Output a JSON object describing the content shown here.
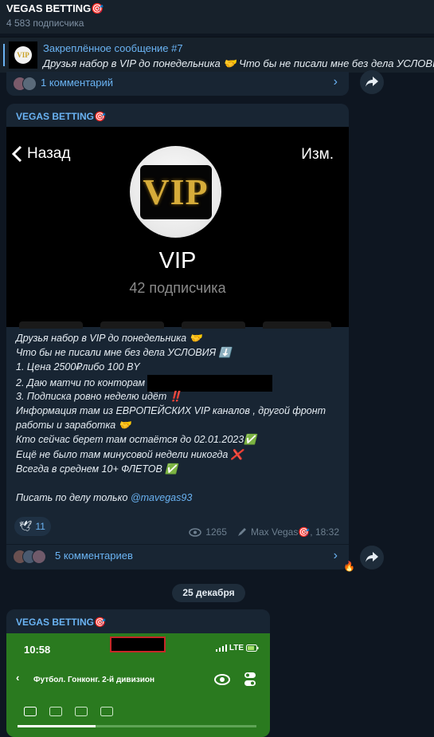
{
  "header": {
    "title": "VEGAS BETTING🎯",
    "subscribers": "4 583 подписчика"
  },
  "pinned": {
    "title": "Закреплённое сообщение #7",
    "text": "Друзья набор в VIP до понедельника 🤝 Что бы не писали мне без дела УСЛОВИЯ",
    "thumb_text": "VIP"
  },
  "top_comments": {
    "label": "1 комментарий"
  },
  "message": {
    "author": "VEGAS BETTING🎯",
    "screenshot": {
      "back": "Назад",
      "edit": "Изм.",
      "logo_text": "VIP",
      "name": "VIP",
      "subs": "42 подписчика"
    },
    "lines": [
      "Друзья набор в VIP до понедельника 🤝",
      "Что бы не писали мне без дела УСЛОВИЯ ⬇️",
      "1. Цена 2500₽либо 100 BY",
      "2. Даю матчи по конторам",
      "3. Подписка ровно неделю идёт ‼️",
      "Информация там из ЕВРОПЕЙСКИХ VIP каналов , другой фронт",
      "работы и заработка 🤝",
      "Кто сейчас берет там остаётся до 02.01.2023✅",
      "Ещё не было там минусовой недели никогда ❌",
      "Всегда в среднем 10+ ФЛЕТОВ ✅",
      "",
      "Писать по делу только "
    ],
    "mention": "@mavegas93",
    "reaction": {
      "emoji": "🕊",
      "count": "11"
    },
    "views": "1265",
    "signature": "Max Vegas🎯, 18:32",
    "comments": "5 комментариев",
    "fire": "🔥"
  },
  "date_separator": "25 декабря",
  "message2": {
    "author": "VEGAS BETTING🎯",
    "phone": {
      "time": "10:58",
      "status": "LTE",
      "league": "Футбол. Гонконг. 2-й дивизион"
    }
  },
  "colors": {
    "bg": "#0e1621",
    "bubble": "#182533",
    "accent": "#6ab3f3",
    "header": "#17212b"
  }
}
